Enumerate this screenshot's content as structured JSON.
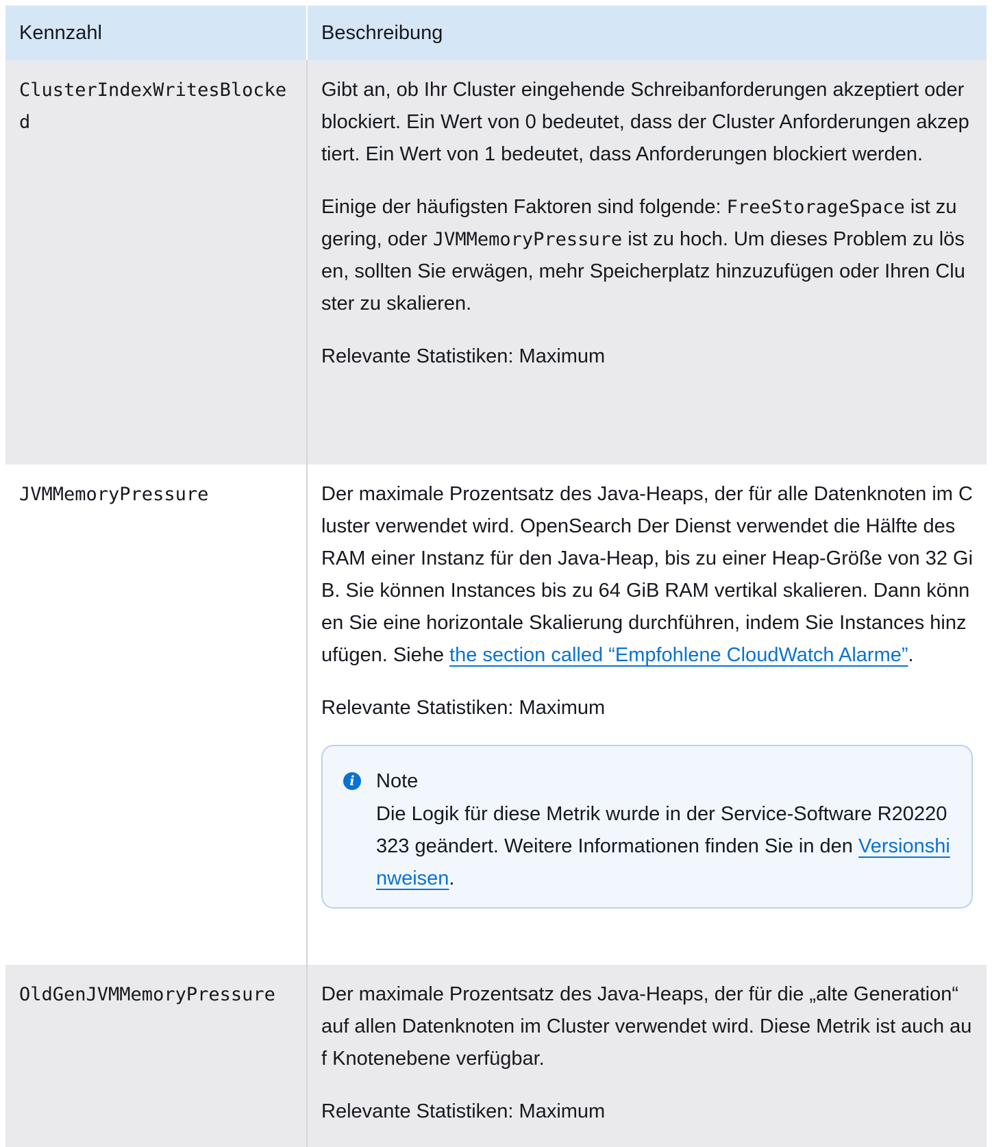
{
  "table": {
    "headers": [
      "Kennzahl",
      "Beschreibung"
    ],
    "rows": [
      {
        "metric": "ClusterIndexWritesBlocked",
        "p1": "Gibt an, ob Ihr Cluster eingehende Schreibanforderungen akzeptiert oder blockiert. Ein Wert von 0 bedeutet, dass der Cluster Anforderungen akzeptiert. Ein Wert von 1 bedeutet, dass Anforderungen blockiert werden.",
        "p2_prefix": "Einige der häufigsten Faktoren sind folgende: ",
        "p2_code1": "FreeStorageSpace",
        "p2_mid": " ist zu gering, oder ",
        "p2_code2": "JVMMemoryPressure",
        "p2_suffix": " ist zu hoch. Um dieses Problem zu lösen, sollten Sie erwägen, mehr Speicherplatz hinzuzufügen oder Ihren Cluster zu skalieren.",
        "stats": "Relevante Statistiken: Maximum"
      },
      {
        "metric": "JVMMemoryPressure",
        "p1_text": "Der maximale Prozentsatz des Java-Heaps, der für alle Datenknoten im Cluster verwendet wird. OpenSearch Der Dienst verwendet die Hälfte des RAM einer Instanz für den Java-Heap, bis zu einer Heap-Größe von 32 GiB. Sie können Instances bis zu 64 GiB RAM vertikal skalieren. Dann können Sie eine horizontale Skalierung durchführen, indem Sie Instances hinzufügen. Siehe ",
        "p1_link": "the section called “Empfohlene CloudWatch Alarme”",
        "p1_end": ".",
        "stats": "Relevante Statistiken: Maximum",
        "note": {
          "icon": "info-icon",
          "title": "Note",
          "body_text": "Die Logik für diese Metrik wurde in der Service-Software R20220323 geändert. Weitere Informationen finden Sie in den ",
          "body_link": "Versionshinweisen",
          "body_end": "."
        }
      },
      {
        "metric": "OldGenJVMMemoryPressure",
        "p1": "Der maximale Prozentsatz des Java-Heaps, der für die „alte Generation“ auf allen Datenknoten im Cluster verwendet wird. Diese Metrik ist auch auf Knotenebene verfügbar.",
        "stats": "Relevante Statistiken: Maximum"
      }
    ]
  },
  "colors": {
    "header_bg": "#d5e6f6",
    "row_gray": "#eaeaec",
    "link": "#0972d3",
    "note_bg": "#f1f7fd",
    "note_border": "#b9d3ec"
  }
}
